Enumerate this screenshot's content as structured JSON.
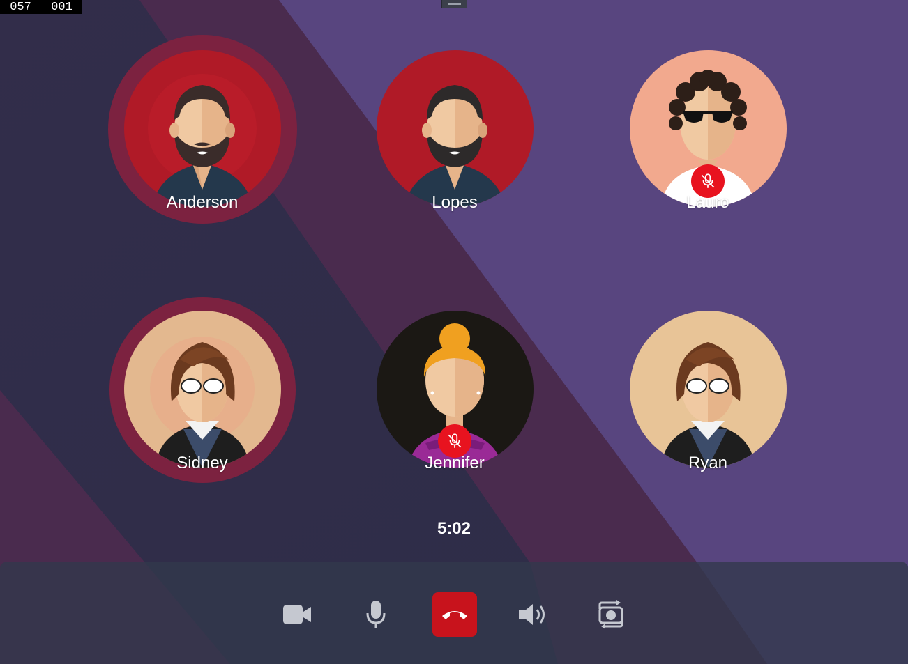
{
  "counter": {
    "left": "057",
    "right": "001"
  },
  "participants": [
    {
      "name": "Anderson",
      "speaking": true,
      "muted": false,
      "avatar_icon": "bearded-man-avatar-icon",
      "avatar_bg": "#b01a27"
    },
    {
      "name": "Lopes",
      "speaking": false,
      "muted": false,
      "avatar_icon": "bearded-man-avatar-icon",
      "avatar_bg": "#b01a27"
    },
    {
      "name": "Lauro",
      "speaking": false,
      "muted": true,
      "avatar_icon": "curly-hair-sunglasses-man-avatar-icon",
      "avatar_bg": "#f2a98e"
    },
    {
      "name": "Sidney",
      "speaking": true,
      "muted": false,
      "avatar_icon": "glasses-man-avatar-icon",
      "avatar_bg": "#e3b88f"
    },
    {
      "name": "Jennifer",
      "speaking": false,
      "muted": true,
      "avatar_icon": "blonde-woman-avatar-icon",
      "avatar_bg": "#1b1814"
    },
    {
      "name": "Ryan",
      "speaking": false,
      "muted": false,
      "avatar_icon": "glasses-man-avatar-icon",
      "avatar_bg": "#e8c497"
    }
  ],
  "call": {
    "timer": "5:02"
  },
  "controls": [
    {
      "id": "camera",
      "icon": "video-camera-icon"
    },
    {
      "id": "microphone",
      "icon": "microphone-icon"
    },
    {
      "id": "hangup",
      "icon": "phone-hangup-icon",
      "color": "#c8131c"
    },
    {
      "id": "speaker",
      "icon": "speaker-volume-icon"
    },
    {
      "id": "switch-camera",
      "icon": "switch-camera-icon"
    }
  ],
  "colors": {
    "speaking_ring": "#7c2240",
    "mute_badge": "#e8131f",
    "background": "#58457f"
  }
}
